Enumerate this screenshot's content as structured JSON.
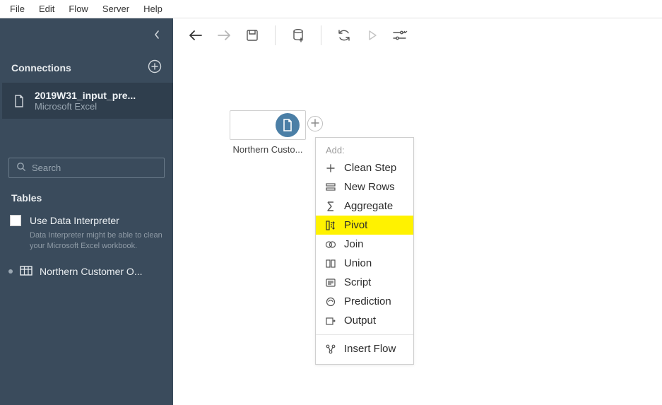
{
  "menubar": [
    "File",
    "Edit",
    "Flow",
    "Server",
    "Help"
  ],
  "sidebar": {
    "sections": {
      "connections_label": "Connections"
    },
    "connection": {
      "title": "2019W31_input_pre...",
      "subtitle": "Microsoft Excel"
    },
    "search": {
      "placeholder": "Search"
    },
    "tables_label": "Tables",
    "interpreter": {
      "label": "Use Data Interpreter",
      "hint": "Data Interpreter might be able to clean your Microsoft Excel workbook."
    },
    "table_item": "Northern Customer O..."
  },
  "canvas": {
    "node_label": "Northern Custo..."
  },
  "add_menu": {
    "header": "Add:",
    "items": [
      {
        "id": "clean-step",
        "label": "Clean Step"
      },
      {
        "id": "new-rows",
        "label": "New Rows"
      },
      {
        "id": "aggregate",
        "label": "Aggregate"
      },
      {
        "id": "pivot",
        "label": "Pivot",
        "highlight": true
      },
      {
        "id": "join",
        "label": "Join"
      },
      {
        "id": "union",
        "label": "Union"
      },
      {
        "id": "script",
        "label": "Script"
      },
      {
        "id": "prediction",
        "label": "Prediction"
      },
      {
        "id": "output",
        "label": "Output"
      }
    ],
    "footer_item": {
      "id": "insert-flow",
      "label": "Insert Flow"
    }
  }
}
